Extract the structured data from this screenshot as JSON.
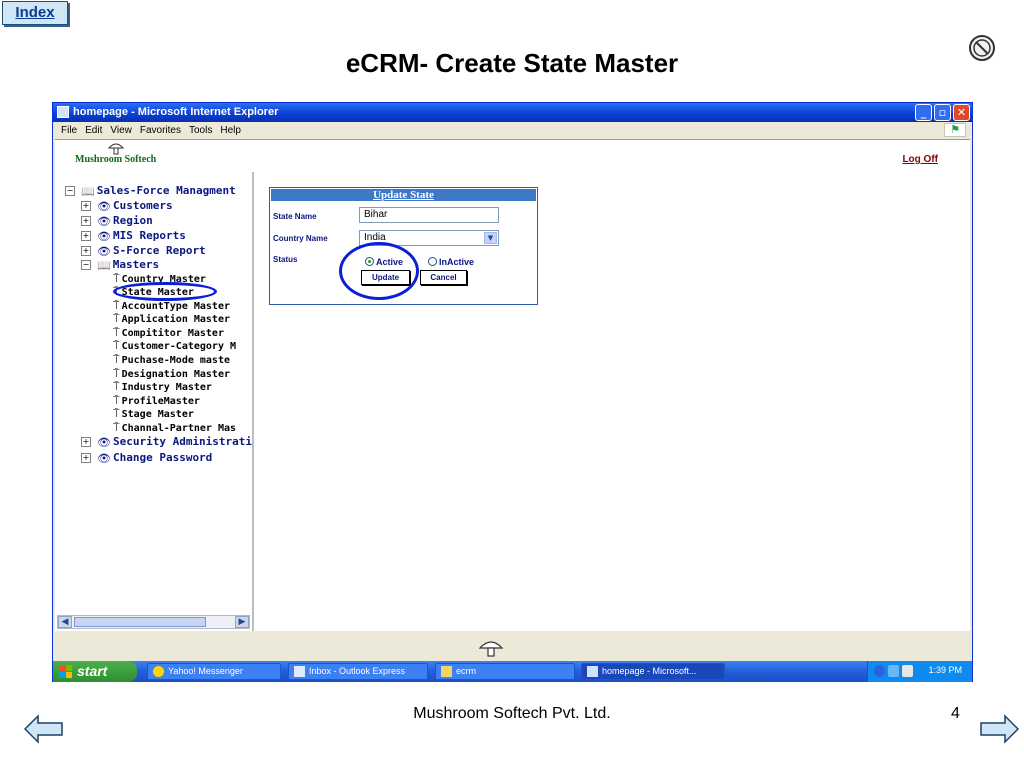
{
  "slide": {
    "index_label": "Index",
    "title": "eCRM- Create State Master",
    "footer": "Mushroom Softech Pvt. Ltd.",
    "page_number": "4"
  },
  "browser": {
    "title": "homepage - Microsoft Internet Explorer",
    "menu": [
      "File",
      "Edit",
      "View",
      "Favorites",
      "Tools",
      "Help"
    ]
  },
  "app": {
    "brand": "Mushroom Softech",
    "logoff": "Log Off"
  },
  "tree": {
    "root": "Sales-Force Managment",
    "top_items": [
      "Customers",
      "Region",
      "MIS Reports",
      "S-Force Report"
    ],
    "masters_label": "Masters",
    "masters_children": [
      "Country Master",
      "State Master",
      "AccountType Master",
      "Application Master",
      "Compititor Master",
      "Customer-Category M",
      "Puchase-Mode maste",
      "Designation Master",
      "Industry Master",
      "ProfileMaster",
      "Stage Master",
      "Channal-Partner Mas"
    ],
    "bottom_items": [
      "Security Administration",
      "Change Password"
    ]
  },
  "form": {
    "header": "Update  State",
    "state_name_label": "State Name",
    "state_name_value": "Bihar",
    "country_name_label": "Country Name",
    "country_value": "India",
    "status_label": "Status",
    "status_active": "Active",
    "status_inactive": "InActive",
    "status_selected": "Active",
    "update_button": "Update",
    "cancel_button": "Cancel"
  },
  "taskbar": {
    "start": "start",
    "tasks": [
      "Yahoo! Messenger",
      "Inbox - Outlook Express",
      "ecrm",
      "homepage - Microsoft..."
    ],
    "active_task": "homepage - Microsoft...",
    "clock": "1:39 PM"
  },
  "colors": {
    "xp_blue": "#0a3dd6",
    "tree_text": "#0b1780",
    "annotation_circle": "#0b20d6",
    "brand_green": "#0c6b1a",
    "logoff_red": "#8b0000"
  },
  "icons": {
    "no_entry": "no-entry-icon",
    "book": "book-icon",
    "eye": "eye-icon",
    "leaf_node": "pin-icon",
    "mushroom": "mushroom-icon",
    "nav_left": "left-arrow-icon",
    "nav_right": "right-arrow-icon"
  }
}
